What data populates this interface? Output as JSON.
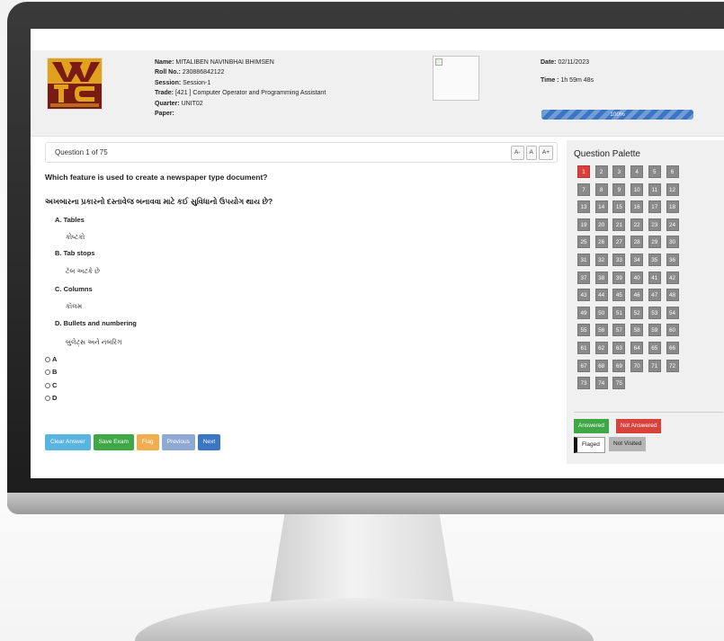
{
  "candidate": {
    "name_label": "Name:",
    "name": "MITALIBEN NAVINBHAI BHIMSEN",
    "roll_label": "Roll No.:",
    "roll": "230886842122",
    "session_label": "Session:",
    "session": "Session-1",
    "trade_label": "Trade:",
    "trade": "[421 ] Computer Operator and Programming Assistant",
    "quarter_label": "Quarter:",
    "quarter": "UNIT02",
    "paper_label": "Paper:",
    "paper": ""
  },
  "exam": {
    "date_label": "Date:",
    "date": "02/11/2023",
    "time_label": "Time :",
    "time": "1h 59m 48s",
    "progress_text": "100%",
    "progress": 1.0
  },
  "question": {
    "counter": "Question 1 of 75",
    "font_buttons": [
      "A-",
      "A",
      "A+"
    ],
    "text_en": "Which feature is used to create a newspaper type document?",
    "text_gu": "અખબારના પ્રકારનો દસ્તાવેજ બનાવવા માટે કઈ સુવિધાનો ઉપયોગ થાય છે?",
    "options": [
      {
        "label": "A. Tables",
        "translation": "કોષ્ટકો"
      },
      {
        "label": "B. Tab stops",
        "translation": "ટૅબ અટકે છે"
      },
      {
        "label": "C. Columns",
        "translation": "કૉલમ"
      },
      {
        "label": "D. Bullets and numbering",
        "translation": "બુલેટ્સ અને નંબરિંગ"
      }
    ],
    "choices": [
      "A",
      "B",
      "C",
      "D"
    ]
  },
  "actions": {
    "clear": "Clear Answer",
    "save": "Save Exam",
    "flag": "Flag",
    "previous": "Previous",
    "next": "Next"
  },
  "palette": {
    "title": "Question Palette",
    "current": 1,
    "total": 75,
    "numbers": [
      "1",
      "2",
      "3",
      "4",
      "5",
      "6",
      "7",
      "8",
      "9",
      "10",
      "11",
      "12",
      "13",
      "14",
      "15",
      "16",
      "17",
      "18",
      "19",
      "20",
      "21",
      "22",
      "23",
      "24",
      "25",
      "26",
      "27",
      "28",
      "29",
      "30",
      "31",
      "32",
      "33",
      "34",
      "35",
      "36",
      "37",
      "38",
      "39",
      "40",
      "41",
      "42",
      "43",
      "44",
      "45",
      "46",
      "47",
      "48",
      "49",
      "50",
      "51",
      "52",
      "53",
      "54",
      "55",
      "56",
      "57",
      "58",
      "59",
      "60",
      "61",
      "62",
      "63",
      "64",
      "65",
      "66",
      "67",
      "68",
      "69",
      "70",
      "71",
      "72",
      "73",
      "74",
      "75"
    ],
    "legend": {
      "answered": "Answered",
      "not_answered": "Not Answered",
      "flagged": "Flaged",
      "not_visited": "Not Visited"
    }
  },
  "colors": {
    "answered": "#3fa745",
    "not_answered": "#d9413b",
    "current": "#d9413b",
    "not_visited": "#b5b5b5",
    "clear": "#5ab4e0",
    "save": "#3fa745",
    "flag": "#f0ad4e",
    "previous": "#8fa9d2",
    "next": "#3a76c4"
  }
}
